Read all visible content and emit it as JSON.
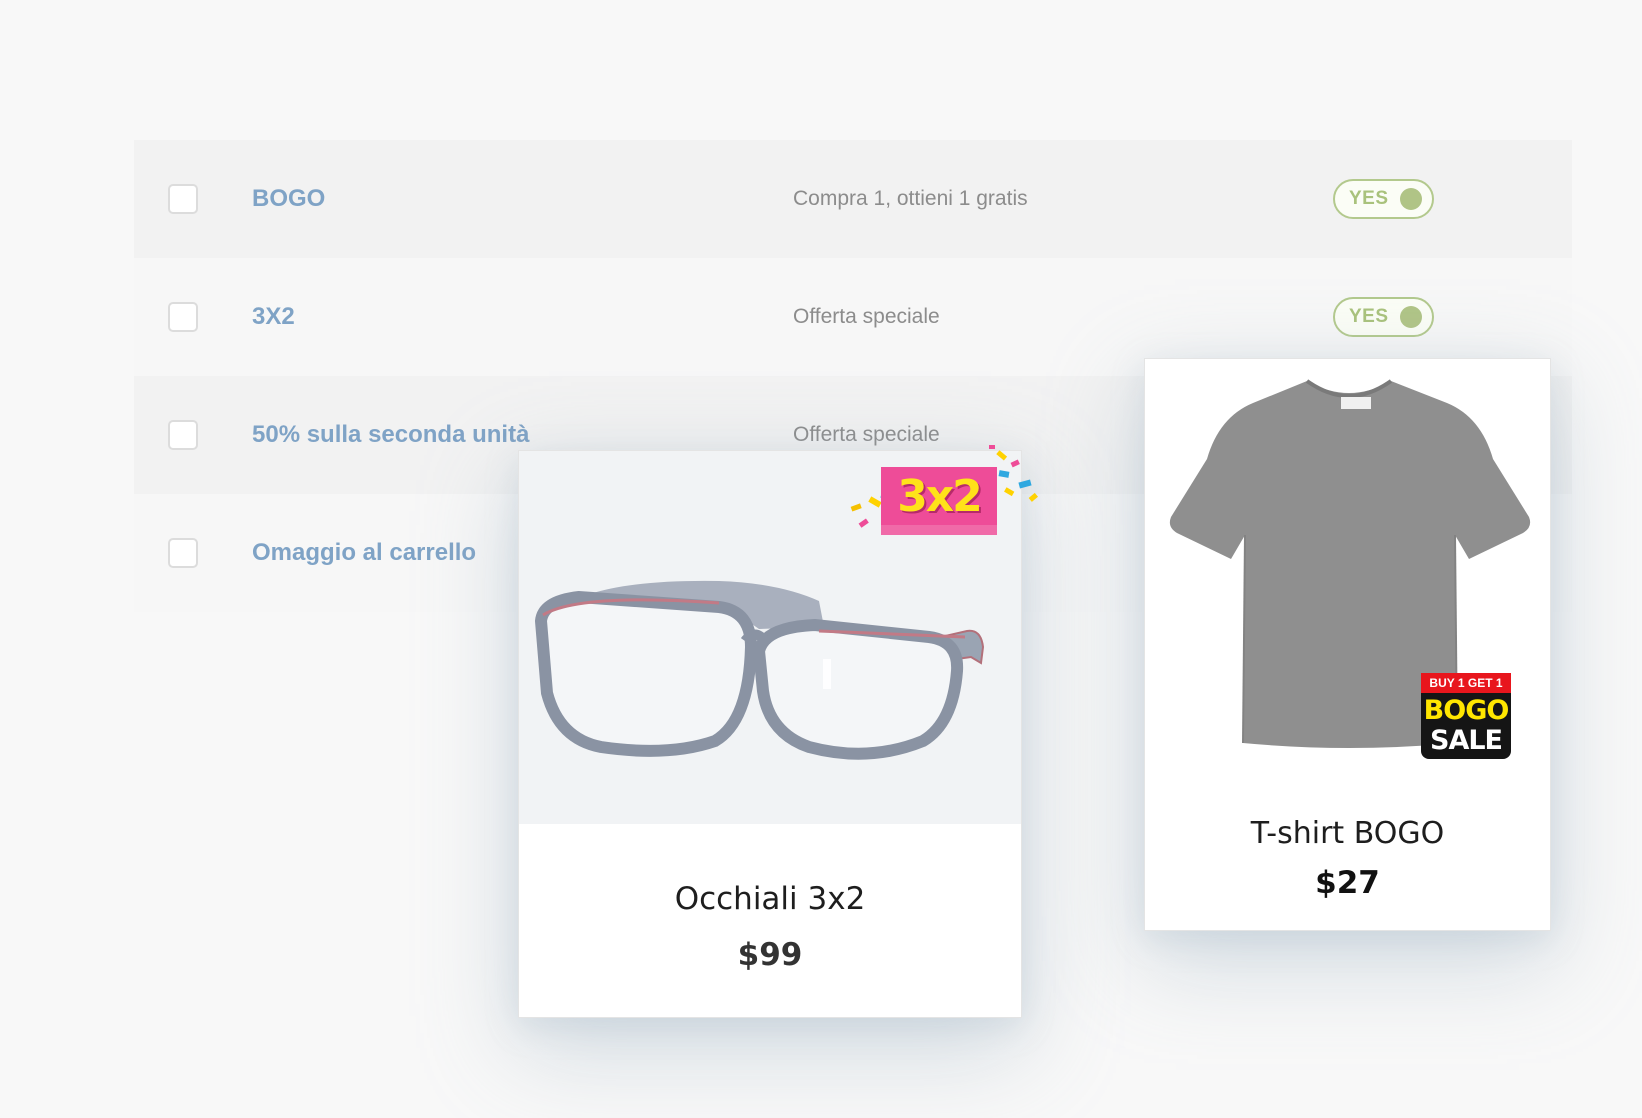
{
  "rules": [
    {
      "name": "BOGO",
      "description": "Compra 1, ottieni 1 gratis",
      "status": "YES"
    },
    {
      "name": "3X2",
      "description": "Offerta speciale",
      "status": "YES"
    },
    {
      "name": "50% sulla seconda unità",
      "description": "Offerta speciale",
      "status": ""
    },
    {
      "name": "Omaggio al carrello",
      "description": "",
      "status": ""
    }
  ],
  "products": {
    "glasses": {
      "title": "Occhiali 3x2",
      "price": "$99",
      "badge": "3x2",
      "icon": "eyeglasses-image"
    },
    "shirt": {
      "title": "T-shirt BOGO",
      "price": "$27",
      "badge_top": "BUY 1 GET 1",
      "badge_line1": "BOGO",
      "badge_line2": "SALE",
      "icon": "tshirt-image"
    }
  },
  "colors": {
    "rule_link": "#7fa3c6",
    "toggle_on": "#b0c486",
    "badge_pink": "#ee4c98",
    "badge_yellow": "#ffe21a",
    "bogo_red": "#e8161d"
  }
}
